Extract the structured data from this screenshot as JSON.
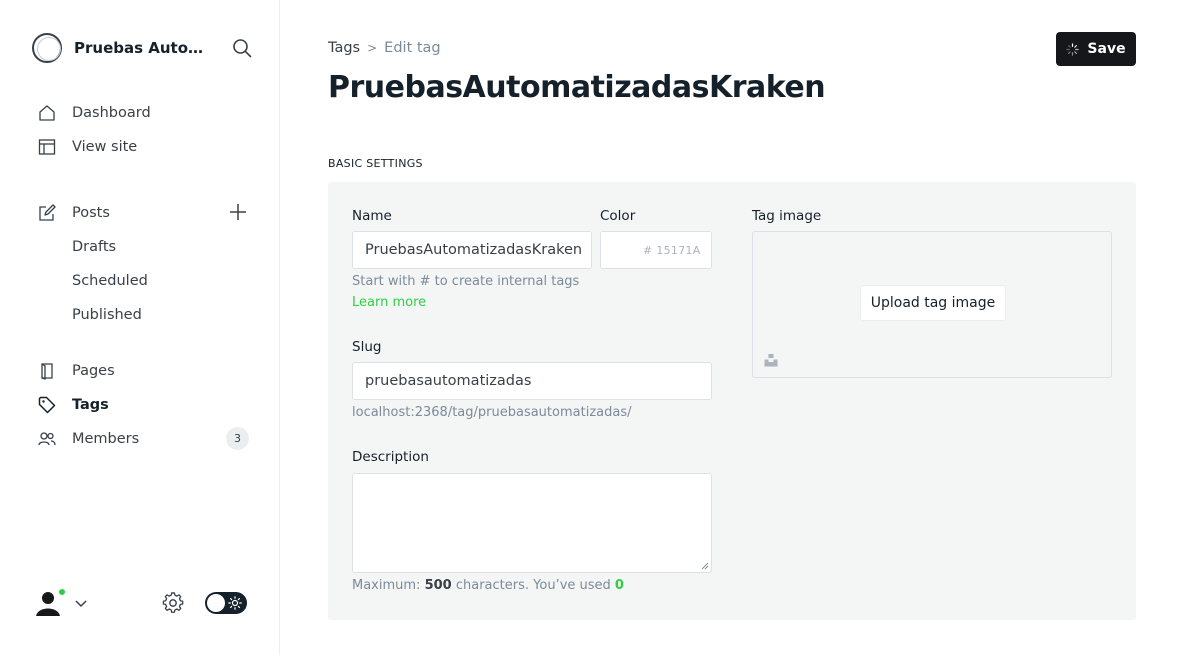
{
  "sidebar": {
    "site_title": "Pruebas Automatizadas Kraken",
    "nav": {
      "dashboard": "Dashboard",
      "view_site": "View site",
      "posts": "Posts",
      "drafts": "Drafts",
      "scheduled": "Scheduled",
      "published": "Published",
      "pages": "Pages",
      "tags": "Tags",
      "members": "Members",
      "members_count": "3"
    }
  },
  "header": {
    "breadcrumb_parent": "Tags",
    "breadcrumb_separator": ">",
    "breadcrumb_current": "Edit tag",
    "title": "PruebasAutomatizadasKraken",
    "save_label": "Save"
  },
  "form": {
    "section_label": "BASIC SETTINGS",
    "name_label": "Name",
    "name_value": "PruebasAutomatizadasKraken",
    "name_hint": "Start with # to create internal tags",
    "learn_more": "Learn more",
    "color_label": "Color",
    "color_placeholder": "# 15171A",
    "slug_label": "Slug",
    "slug_value": "pruebasautomatizadas",
    "slug_url": "localhost:2368/tag/pruebasautomatizadas/",
    "description_label": "Description",
    "description_value": "",
    "counter_prefix": "Maximum:",
    "counter_max": "500",
    "counter_mid": "characters. You’ve used",
    "counter_used": "0",
    "tag_image_label": "Tag image",
    "upload_label": "Upload tag image"
  },
  "colors": {
    "accent": "#30cf43",
    "dark": "#15171a",
    "panel_bg": "#f4f5f5"
  },
  "icons": {
    "brand": "ghost-logo-icon",
    "search": "search-icon",
    "dashboard": "home-icon",
    "view_site": "layout-icon",
    "posts": "pencil-icon",
    "add_post": "plus-icon",
    "pages": "page-icon",
    "tags": "tag-icon",
    "members": "members-icon",
    "settings": "gear-icon",
    "theme": "sun-icon",
    "unsplash": "unsplash-icon"
  }
}
